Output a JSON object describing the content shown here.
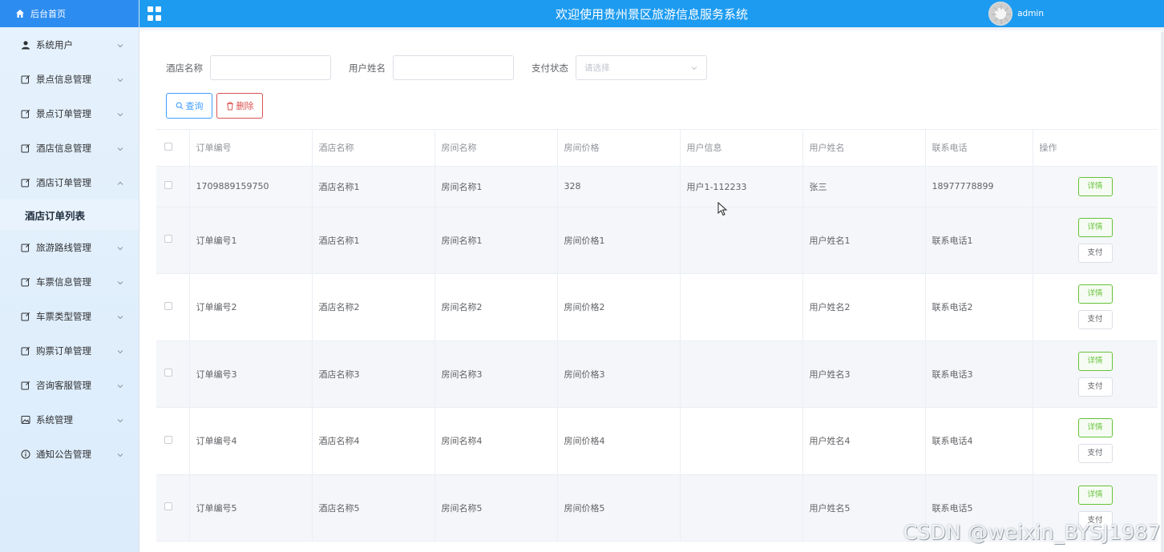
{
  "sidebar": {
    "home_label": "后台首页",
    "items": [
      {
        "label": "系统用户",
        "icon": "user-icon"
      },
      {
        "label": "景点信息管理",
        "icon": "edit-icon"
      },
      {
        "label": "景点订单管理",
        "icon": "edit-icon"
      },
      {
        "label": "酒店信息管理",
        "icon": "edit-icon"
      },
      {
        "label": "酒店订单管理",
        "icon": "edit-icon",
        "expanded": true
      },
      {
        "label": "旅游路线管理",
        "icon": "edit-icon"
      },
      {
        "label": "车票信息管理",
        "icon": "edit-icon"
      },
      {
        "label": "车票类型管理",
        "icon": "edit-icon"
      },
      {
        "label": "购票订单管理",
        "icon": "edit-icon"
      },
      {
        "label": "咨询客服管理",
        "icon": "edit-icon"
      },
      {
        "label": "系统管理",
        "icon": "picture-icon"
      },
      {
        "label": "通知公告管理",
        "icon": "info-icon"
      }
    ],
    "submenu_active": "酒店订单列表"
  },
  "topbar": {
    "title": "欢迎使用贵州景区旅游信息服务系统",
    "username": "admin"
  },
  "filters": {
    "hotel_name_label": "酒店名称",
    "hotel_name_value": "",
    "user_name_label": "用户姓名",
    "user_name_value": "",
    "pay_status_label": "支付状态",
    "pay_status_placeholder": "请选择"
  },
  "actions": {
    "query_label": "查询",
    "delete_label": "删除"
  },
  "table": {
    "headers": [
      "订单编号",
      "酒店名称",
      "房间名称",
      "房间价格",
      "用户信息",
      "用户姓名",
      "联系电话",
      "操作"
    ],
    "detail_label": "详情",
    "pay_label": "支付",
    "rows": [
      {
        "order_no": "1709889159750",
        "hotel": "酒店名称1",
        "room": "房间名称1",
        "price": "328",
        "user_info": "用户1-112233",
        "user_name": "张三",
        "phone": "18977778899",
        "pay": false
      },
      {
        "order_no": "订单编号1",
        "hotel": "酒店名称1",
        "room": "房间名称1",
        "price": "房间价格1",
        "user_info": "",
        "user_name": "用户姓名1",
        "phone": "联系电话1",
        "pay": true
      },
      {
        "order_no": "订单编号2",
        "hotel": "酒店名称2",
        "room": "房间名称2",
        "price": "房间价格2",
        "user_info": "",
        "user_name": "用户姓名2",
        "phone": "联系电话2",
        "pay": true
      },
      {
        "order_no": "订单编号3",
        "hotel": "酒店名称3",
        "room": "房间名称3",
        "price": "房间价格3",
        "user_info": "",
        "user_name": "用户姓名3",
        "phone": "联系电话3",
        "pay": true
      },
      {
        "order_no": "订单编号4",
        "hotel": "酒店名称4",
        "room": "房间名称4",
        "price": "房间价格4",
        "user_info": "",
        "user_name": "用户姓名4",
        "phone": "联系电话4",
        "pay": true
      },
      {
        "order_no": "订单编号5",
        "hotel": "酒店名称5",
        "room": "房间名称5",
        "price": "房间价格5",
        "user_info": "",
        "user_name": "用户姓名5",
        "phone": "联系电话5",
        "pay": true
      }
    ]
  },
  "watermark": "CSDN @weixin_BYSJ1987"
}
